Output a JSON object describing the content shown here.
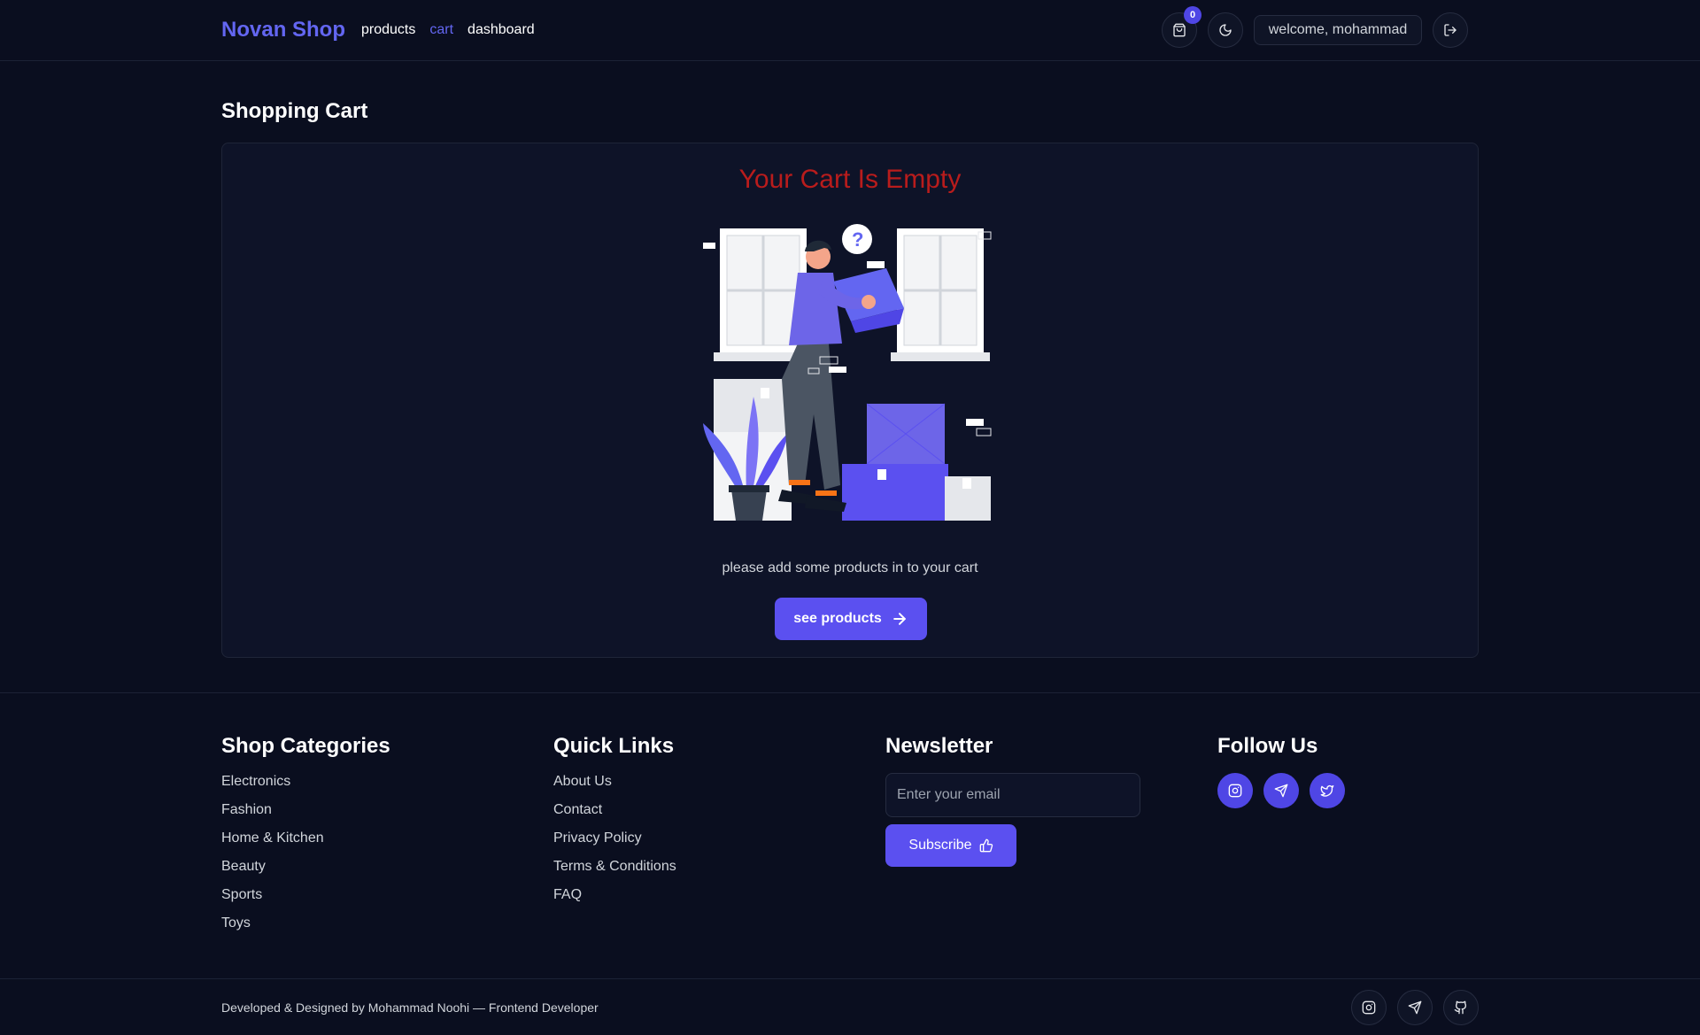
{
  "header": {
    "brand": "Novan Shop",
    "nav": [
      {
        "label": "products",
        "active": false
      },
      {
        "label": "cart",
        "active": true
      },
      {
        "label": "dashboard",
        "active": false
      }
    ],
    "cart_count": "0",
    "welcome": "welcome, mohammad",
    "icons": {
      "cart": "shopping-bag-icon",
      "theme": "moon-icon",
      "logout": "logout-icon"
    }
  },
  "main": {
    "page_title": "Shopping Cart",
    "empty_title": "Your Cart Is Empty",
    "empty_message": "please add some products in to your cart",
    "button_label": "see products"
  },
  "footer": {
    "categories": {
      "title": "Shop Categories",
      "items": [
        "Electronics",
        "Fashion",
        "Home & Kitchen",
        "Beauty",
        "Sports",
        "Toys"
      ]
    },
    "quick_links": {
      "title": "Quick Links",
      "items": [
        "About Us",
        "Contact",
        "Privacy Policy",
        "Terms & Conditions",
        "FAQ"
      ]
    },
    "newsletter": {
      "title": "Newsletter",
      "placeholder": "Enter your email",
      "button_label": "Subscribe"
    },
    "follow": {
      "title": "Follow Us",
      "icons": [
        "instagram-icon",
        "telegram-icon",
        "twitter-icon"
      ]
    },
    "credit": "Developed & Designed by Mohammad Noohi — Frontend Developer",
    "bottom_icons": [
      "instagram-icon",
      "telegram-icon",
      "github-icon"
    ]
  },
  "colors": {
    "background": "#0a0e1f",
    "accent": "#5b50f0",
    "brand": "#6366f1",
    "empty_title": "#b91c1c"
  }
}
